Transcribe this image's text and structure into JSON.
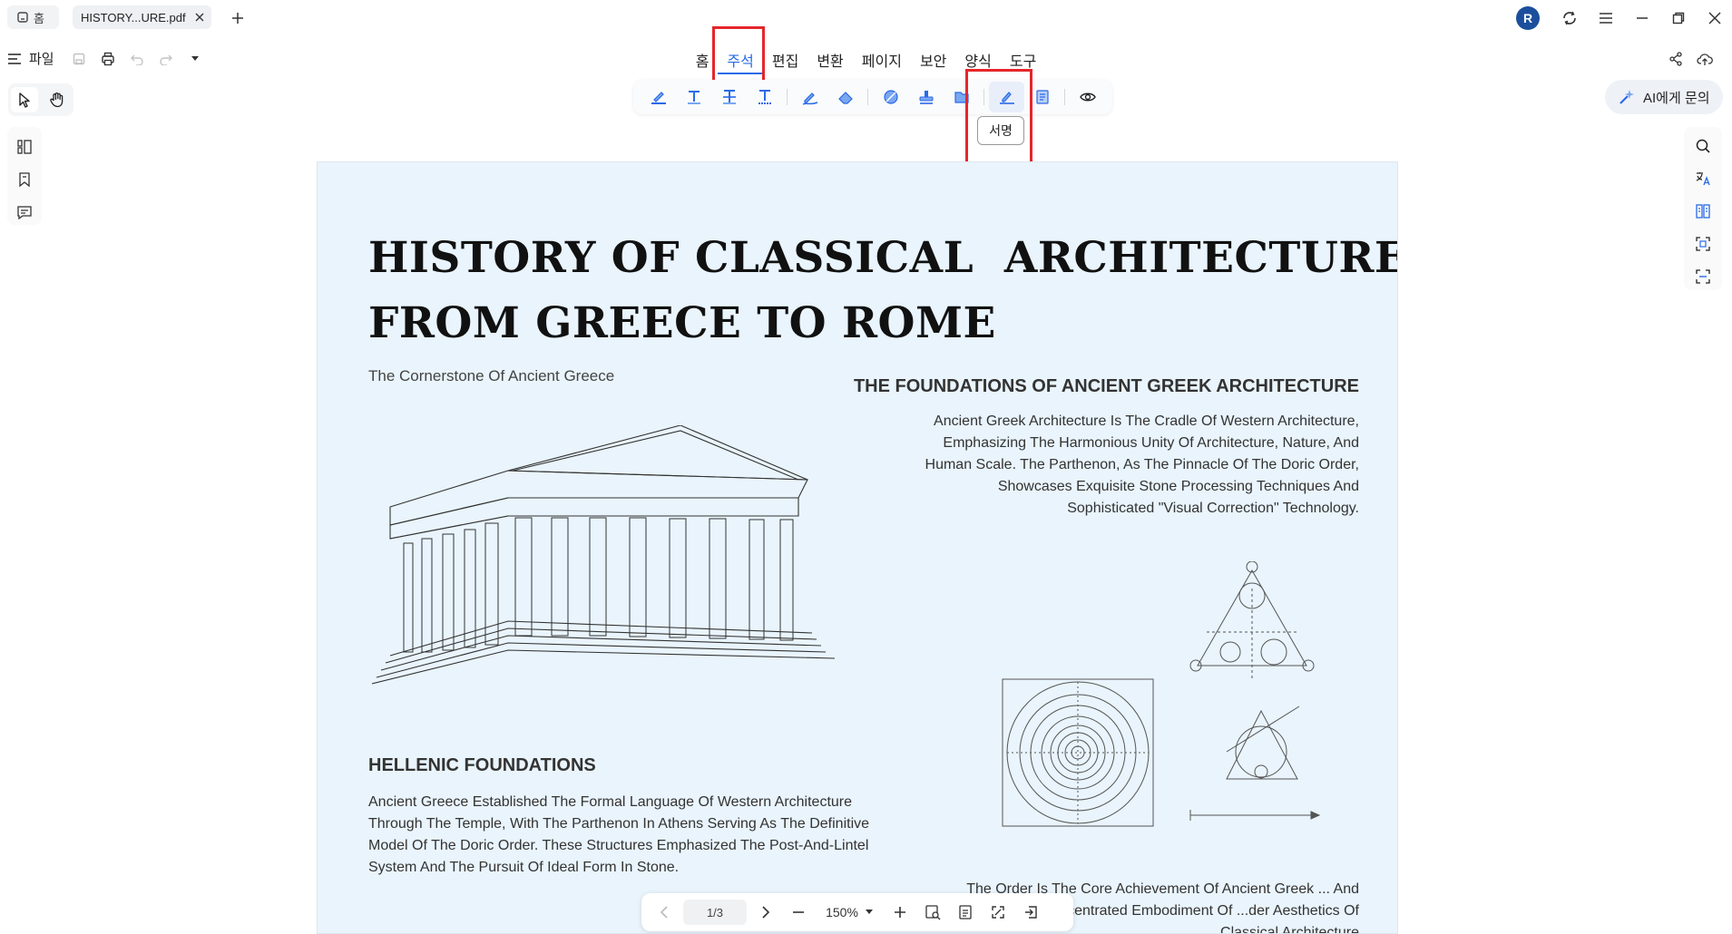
{
  "titlebar": {
    "home_tab_label": "홈",
    "doc_tab_label": "HISTORY...URE.pdf",
    "avatar_initial": "R"
  },
  "menubar": {
    "file_label": "파일",
    "tabs": [
      {
        "label": "홈"
      },
      {
        "label": "주석"
      },
      {
        "label": "편집"
      },
      {
        "label": "변환"
      },
      {
        "label": "페이지"
      },
      {
        "label": "보안"
      },
      {
        "label": "양식"
      },
      {
        "label": "도구"
      }
    ],
    "active_tab": "주석"
  },
  "annotation_toolbar": {
    "tools": [
      "highlight-icon",
      "text-icon",
      "strikethrough-icon",
      "underline-icon",
      "pen-icon",
      "eraser-icon",
      "shape-icon",
      "stamp-icon",
      "attachment-icon",
      "signature-icon",
      "measure-icon",
      "eye-icon"
    ],
    "active_tool": "signature-icon",
    "tooltip": "서명"
  },
  "ask_ai_label": "AI에게 문의",
  "document": {
    "title_line1": "HISTORY OF CLASSICAL  ARCHITECTURE:",
    "title_line2": "FROM GREECE TO ROME",
    "subtitle": "The Cornerstone Of Ancient Greece",
    "right_heading": "THE FOUNDATIONS OF ANCIENT GREEK ARCHITECTURE",
    "right_paragraph": "Ancient Greek Architecture Is The Cradle Of Western Architecture, Emphasizing The Harmonious Unity Of Architecture, Nature, And Human Scale. The Parthenon, As The Pinnacle Of The Doric Order, Showcases Exquisite Stone Processing Techniques And Sophisticated \"Visual Correction\" Technology.",
    "left_heading": "HELLENIC FOUNDATIONS",
    "left_paragraph": "Ancient Greece Established The Formal Language Of Western Architecture Through The Temple, With The Parthenon In Athens Serving As The Definitive Model Of The Doric Order. These Structures Emphasized The Post-And-Lintel System And The Pursuit Of Ideal Form In Stone.",
    "right_paragraph2": "The Order Is The Core Achievement Of Ancient Greek ... And The Concentrated Embodiment Of ...der Aesthetics Of Classical Architecture"
  },
  "bottom_bar": {
    "page_indicator": "1/3",
    "zoom": "150%"
  },
  "colors": {
    "accent": "#2a6ae8",
    "highlight_box": "#e5262c",
    "page_bg": "#e9f4fc"
  }
}
